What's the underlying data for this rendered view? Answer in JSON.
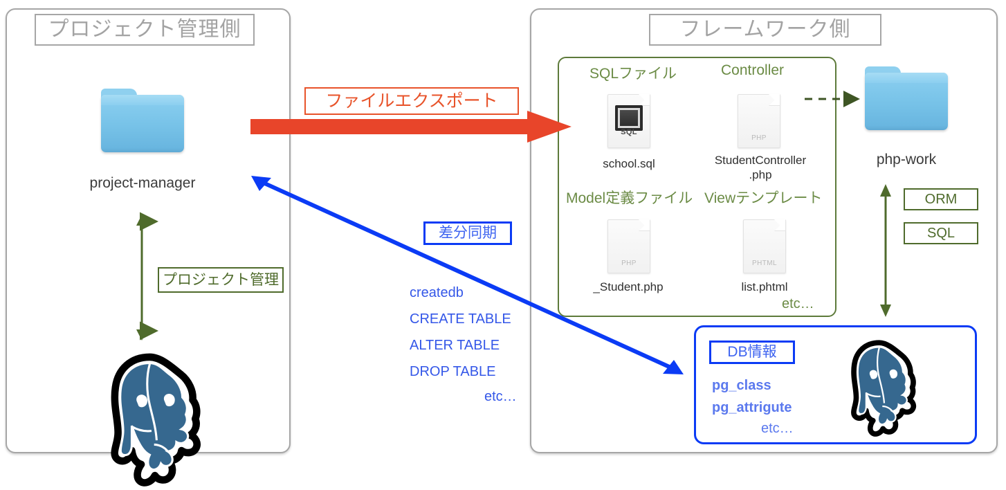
{
  "left_panel": {
    "title": "プロジェクト管理側",
    "folder": {
      "name": "project-manager",
      "icon": "folder-icon"
    },
    "relation_label": "プロジェクト管理",
    "database_icon": "postgresql-elephant-icon"
  },
  "right_panel": {
    "title": "フレームワーク側",
    "green_group": {
      "files": [
        {
          "group": "SQLファイル",
          "icon": "sql-file-icon",
          "tag": "SQL",
          "caption": "school.sql"
        },
        {
          "group": "Controller",
          "icon": "php-file-icon",
          "tag": "PHP",
          "caption": "StudentController\n.php"
        },
        {
          "group": "Model定義ファイル",
          "icon": "php-file-icon",
          "tag": "PHP",
          "caption": "_Student.php"
        },
        {
          "group": "Viewテンプレート",
          "icon": "phtml-file-icon",
          "tag": "PHTML",
          "caption": "list.phtml"
        }
      ],
      "file_captions": {
        "school": "school.sql",
        "controller_line1": "StudentController",
        "controller_line2": ".php",
        "model": "_Student.php",
        "view": "list.phtml"
      },
      "group_labels": {
        "sql": "SQLファイル",
        "controller": "Controller",
        "model": "Model定義ファイル",
        "view": "Viewテンプレート"
      },
      "file_tags": {
        "sql": "SQL",
        "php": "PHP",
        "phtml": "PHTML"
      },
      "etc": "etc…"
    },
    "work_folder": {
      "name": "php-work",
      "icon": "folder-icon"
    },
    "access_tags": [
      "ORM",
      "SQL"
    ],
    "blue_group": {
      "title": "DB情報",
      "items": [
        "pg_class",
        "pg_attrigute"
      ],
      "etc": "etc…",
      "database_icon": "postgresql-elephant-icon"
    }
  },
  "connections": {
    "export_label": "ファイルエクスポート",
    "sync_label": "差分同期",
    "sql_commands": [
      "createdb",
      "CREATE TABLE",
      "ALTER TABLE",
      "DROP TABLE"
    ],
    "sql_commands_etc": "etc…"
  },
  "colors": {
    "panel_border": "#a6a6a6",
    "panel_title_text": "#a3a3a3",
    "red_accent": "#e8532a",
    "green_accent": "#4f6b2c",
    "green_group": "#5d7a3a",
    "green_label": "#6b8b45",
    "blue_accent": "#0b3bf5",
    "blue_text": "#3457e8",
    "folder_blue": "#79c4e9",
    "postgres_blue": "#36688f"
  }
}
